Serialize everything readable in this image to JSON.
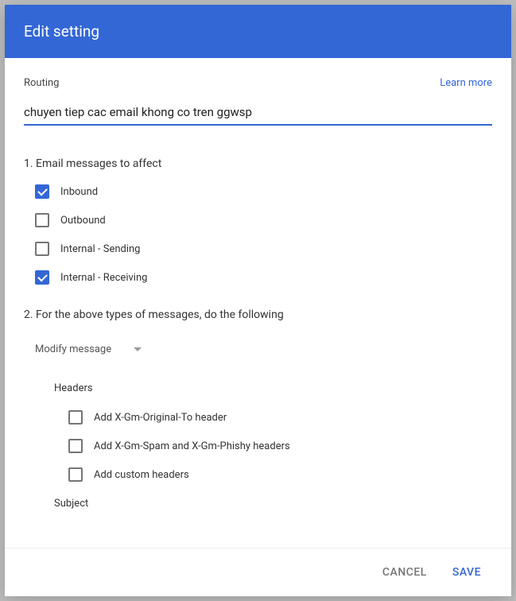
{
  "header": {
    "title": "Edit setting"
  },
  "topRow": {
    "routingLabel": "Routing",
    "learnMore": "Learn more"
  },
  "descriptionInput": {
    "value": "chuyen tiep cac email khong co tren ggwsp"
  },
  "section1": {
    "title": "1. Email messages to affect",
    "options": [
      {
        "label": "Inbound",
        "checked": true
      },
      {
        "label": "Outbound",
        "checked": false
      },
      {
        "label": "Internal - Sending",
        "checked": false
      },
      {
        "label": "Internal - Receiving",
        "checked": true
      }
    ]
  },
  "section2": {
    "title": "2. For the above types of messages, do the following",
    "dropdown": {
      "selected": "Modify message"
    },
    "headers": {
      "title": "Headers",
      "options": [
        {
          "label": "Add X-Gm-Original-To header",
          "checked": false
        },
        {
          "label": "Add X-Gm-Spam and X-Gm-Phishy headers",
          "checked": false
        },
        {
          "label": "Add custom headers",
          "checked": false
        }
      ]
    },
    "subject": {
      "title": "Subject"
    }
  },
  "footer": {
    "cancel": "Cancel",
    "save": "Save"
  }
}
